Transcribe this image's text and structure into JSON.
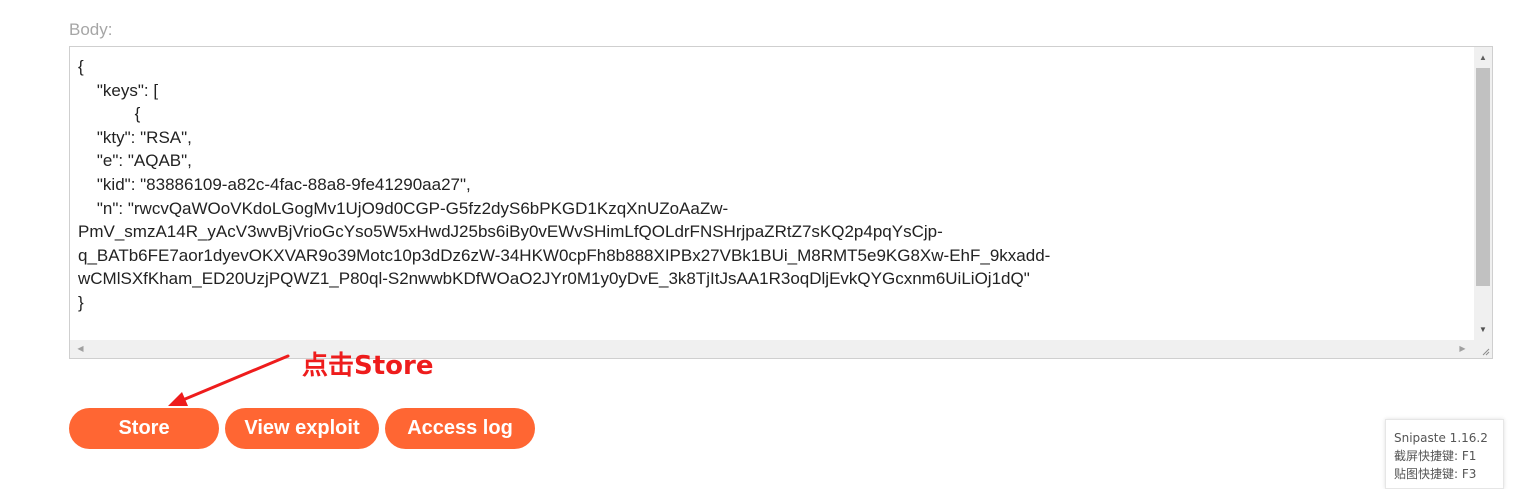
{
  "form": {
    "body_label": "Body:",
    "body_text": "{\n    \"keys\": [\n            {\n    \"kty\": \"RSA\",\n    \"e\": \"AQAB\",\n    \"kid\": \"83886109-a82c-4fac-88a8-9fe41290aa27\",\n    \"n\": \"rwcvQaWOoVKdoLGogMv1UjO9d0CGP-G5fz2dyS6bPKGD1KzqXnUZoAaZw-\nPmV_smzA14R_yAcV3wvBjVrioGcYso5W5xHwdJ25bs6iBy0vEWvSHimLfQOLdrFNSHrjpaZRtZ7sKQ2p4pqYsCjp-\nq_BATb6FE7aor1dyevOKXVAR9o39Motc10p3dDz6zW-34HKW0cpFh8b888XIPBx27VBk1BUi_M8RMT5e9KG8Xw-EhF_9kxadd-\nwCMlSXfKham_ED20UzjPQWZ1_P80ql-S2nwwbKDfWOaO2JYr0M1y0yDvE_3k8TjItJsAA1R3oqDljEvkQYGcxnm6UiLiOj1dQ\"\n}\n\n    ]"
  },
  "annotation": {
    "text": "点击Store",
    "color": "#ee1c1c"
  },
  "buttons": {
    "store_label": "Store",
    "view_exploit_label": "View exploit",
    "access_log_label": "Access log",
    "color": "#ff6633"
  },
  "snipaste": {
    "title": "Snipaste 1.16.2",
    "line1": "截屏快捷键: F1",
    "line2": "贴图快捷键: F3"
  }
}
